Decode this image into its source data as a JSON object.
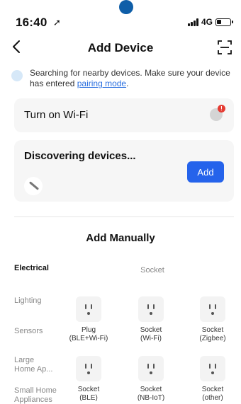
{
  "status_bar": {
    "time": "16:40",
    "network": "4G"
  },
  "header": {
    "title": "Add Device"
  },
  "info": {
    "text": "Searching for nearby devices. Make sure your device has entered ",
    "link": "pairing mode",
    "suffix": "."
  },
  "wifi_card": {
    "label": "Turn on Wi-Fi",
    "badge": "!"
  },
  "discover_card": {
    "label": "Discovering devices...",
    "add_label": "Add"
  },
  "manual": {
    "title": "Add Manually",
    "section": "Socket"
  },
  "categories": [
    {
      "label": "Electrical",
      "active": true
    },
    {
      "label": "Lighting"
    },
    {
      "label": "Sensors"
    },
    {
      "label": "Large Home Ap..."
    },
    {
      "label": "Small Home Appliances"
    }
  ],
  "devices": [
    {
      "name": "Plug\n(BLE+Wi-Fi)"
    },
    {
      "name": "Socket\n(Wi-Fi)"
    },
    {
      "name": "Socket\n(Zigbee)"
    },
    {
      "name": "Socket\n(BLE)"
    },
    {
      "name": "Socket\n(NB-IoT)"
    },
    {
      "name": "Socket\n(other)"
    }
  ]
}
